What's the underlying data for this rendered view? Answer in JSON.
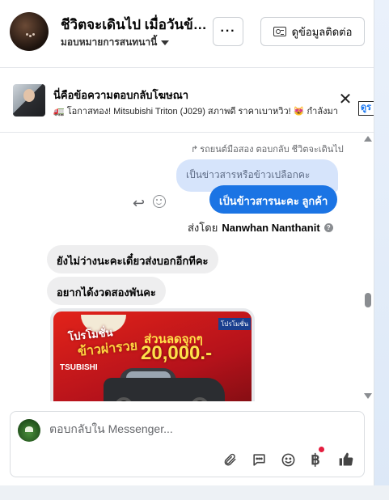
{
  "header": {
    "page_title": "ชีวิตจะเดินไป เมื่อวันข้างหน้า",
    "assigned_to": "มอบหมายการสนทนานี้",
    "more_label": "···",
    "contact_info_label": "ดูข้อมูลติดต่อ"
  },
  "ad": {
    "title": "นี่คือข้อความตอบกลับโฆษณา",
    "text": "🚛 โอกาสทอง! Mitsubishi Triton (J029) สภาพดี ราคาเบาหวิว! 😻 กำลังมา",
    "close_label": "✕",
    "tag_label": "ดูร"
  },
  "conversation": {
    "reply_note": "รถยนต์มือสอง ตอบกลับ ชีวิตจะเดินไป",
    "quoted_message": "เป็นข่าวสารหรือข้าวเปลือกคะ",
    "sent_message": "เป็นข้าวสารนะคะ  ลูกค้า",
    "sent_by_prefix": "ส่งโดย",
    "sent_by_name": "Nanwhan Nanthanit",
    "incoming_messages": [
      "ยังไม่ว่างนะคะเดี๋ยวส่งบอกอีกทีคะ",
      "อยากได้งวดสองพันคะ"
    ],
    "image_promo": {
      "line1": "โปรโมชั่น",
      "line2": "ข้าวผ่ารวย",
      "brand": "TSUBISHI",
      "headline": "ส่วนลดจุกๆ",
      "amount": "20,000.-",
      "tag": "โปรโมชั่น"
    }
  },
  "composer": {
    "placeholder": "ตอบกลับใน Messenger..."
  },
  "icons": {
    "more": "more-icon",
    "contact": "contact-card-icon",
    "close": "close-icon",
    "reply": "reply-icon",
    "react": "emoji-react-icon",
    "info": "info-icon",
    "attach": "paperclip-icon",
    "saved_reply": "chat-bubble-icon",
    "emoji": "emoji-icon",
    "payment": "baht-icon",
    "like": "thumbs-up-icon"
  },
  "colors": {
    "primary": "#1b74e4",
    "quoted_bubble": "#d6e4fb",
    "incoming_bubble": "#eeeeef",
    "notification": "#e41e3f",
    "promo_red": "#e2231a"
  }
}
